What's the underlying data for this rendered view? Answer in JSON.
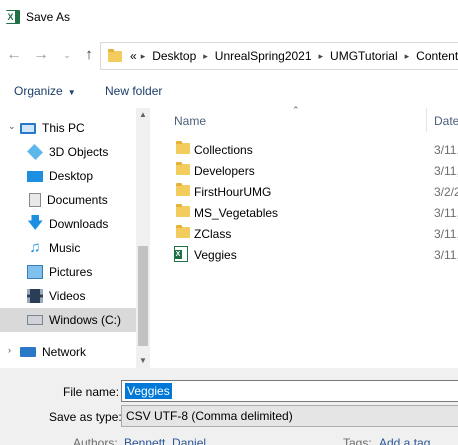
{
  "window": {
    "title": "Save As",
    "app_icon": "excel-icon"
  },
  "navigation": {
    "back_icon": "arrow-left-icon",
    "forward_icon": "arrow-right-icon",
    "recent_icon": "chevron-down-icon",
    "up_icon": "arrow-up-icon",
    "overflow": "«",
    "breadcrumb": [
      "Desktop",
      "UnrealSpring2021",
      "UMGTutorial",
      "Content"
    ]
  },
  "toolbar": {
    "organize_label": "Organize",
    "new_folder_label": "New folder"
  },
  "sidebar": {
    "items": [
      {
        "label": "This PC",
        "icon": "computer-icon"
      },
      {
        "label": "3D Objects",
        "icon": "3d-objects-icon"
      },
      {
        "label": "Desktop",
        "icon": "desktop-icon"
      },
      {
        "label": "Documents",
        "icon": "documents-icon"
      },
      {
        "label": "Downloads",
        "icon": "downloads-icon"
      },
      {
        "label": "Music",
        "icon": "music-icon"
      },
      {
        "label": "Pictures",
        "icon": "pictures-icon"
      },
      {
        "label": "Videos",
        "icon": "videos-icon"
      },
      {
        "label": "Windows (C:)",
        "icon": "drive-icon",
        "selected": true
      },
      {
        "label": "Network",
        "icon": "network-icon"
      }
    ]
  },
  "file_list": {
    "columns": {
      "name": "Name",
      "date": "Date"
    },
    "rows": [
      {
        "name": "Collections",
        "date": "3/11,",
        "type": "folder"
      },
      {
        "name": "Developers",
        "date": "3/11,",
        "type": "folder"
      },
      {
        "name": "FirstHourUMG",
        "date": "3/2/2",
        "type": "folder"
      },
      {
        "name": "MS_Vegetables",
        "date": "3/11,",
        "type": "folder"
      },
      {
        "name": "ZClass",
        "date": "3/11,",
        "type": "folder"
      },
      {
        "name": "Veggies",
        "date": "3/11,",
        "type": "excel"
      }
    ]
  },
  "form": {
    "file_name_label": "File name:",
    "file_name_value": "Veggies",
    "save_type_label": "Save as type:",
    "save_type_value": "CSV UTF-8 (Comma delimited)",
    "authors_label": "Authors:",
    "authors_value": "Bennett, Daniel",
    "tags_label": "Tags:",
    "tags_value": "Add a tag"
  },
  "colors": {
    "accent": "#0078d7",
    "folder": "#f2cc5c",
    "excel": "#1e7145"
  }
}
